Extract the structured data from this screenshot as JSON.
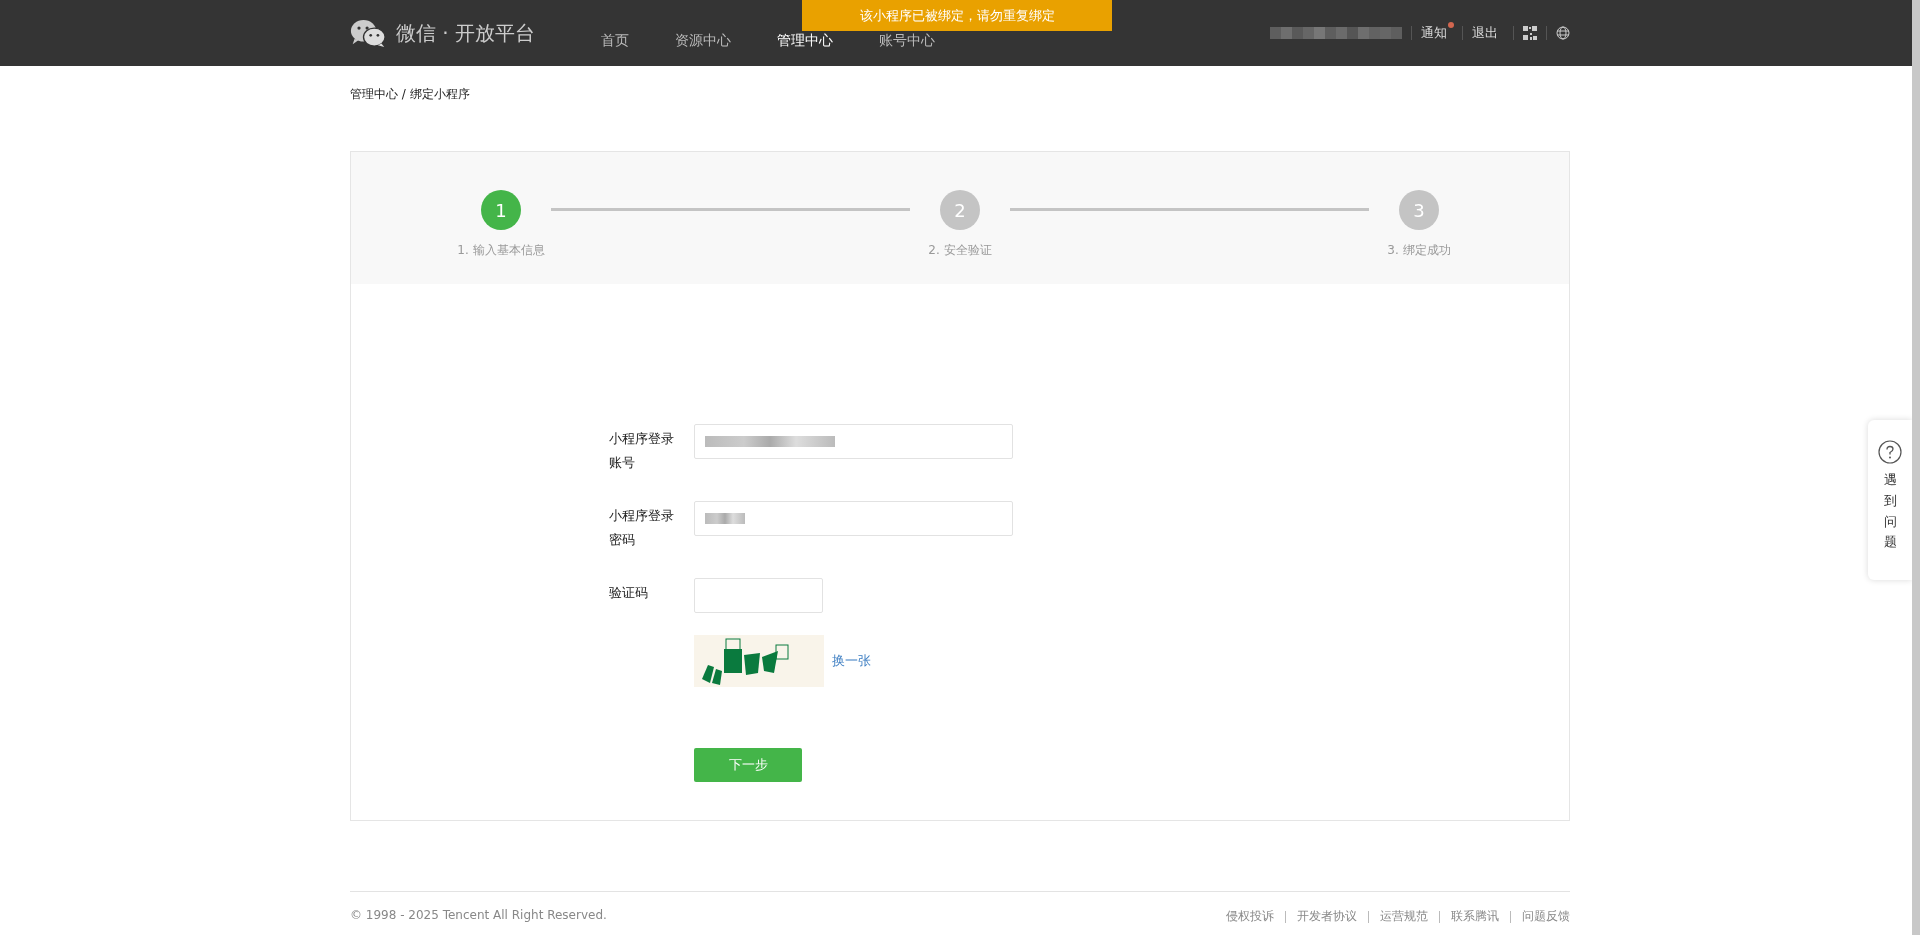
{
  "header": {
    "brand": "微信 · 开放平台",
    "nav": [
      {
        "label": "首页",
        "selected": false
      },
      {
        "label": "资源中心",
        "selected": false
      },
      {
        "label": "管理中心",
        "selected": true
      },
      {
        "label": "账号中心",
        "selected": false
      }
    ],
    "links": [
      {
        "label": "通知",
        "unread": true
      },
      {
        "label": "退出",
        "unread": false
      }
    ]
  },
  "toast": "该小程序已被绑定，请勿重复绑定",
  "breadcrumb": "管理中心 / 绑定小程序",
  "steps": [
    {
      "number": "1",
      "label": "1. 输入基本信息",
      "selected": true
    },
    {
      "number": "2",
      "label": "2. 安全验证",
      "selected": false
    },
    {
      "number": "3",
      "label": "3. 绑定成功",
      "selected": false
    }
  ],
  "form": {
    "fields": [
      {
        "label": "小程序登录账号",
        "kind": "redacted"
      },
      {
        "label": "小程序登录密码",
        "kind": "redacted"
      },
      {
        "label": "验证码",
        "kind": "captcha"
      }
    ],
    "refresh_link": "换一张",
    "submit": "下一步"
  },
  "help": "遇到问题",
  "footer": {
    "copyright": "© 1998 - 2025 Tencent All Right Reserved.",
    "links": [
      "侵权投诉",
      "开发者协议",
      "运营规范",
      "联系腾讯",
      "问题反馈"
    ]
  }
}
